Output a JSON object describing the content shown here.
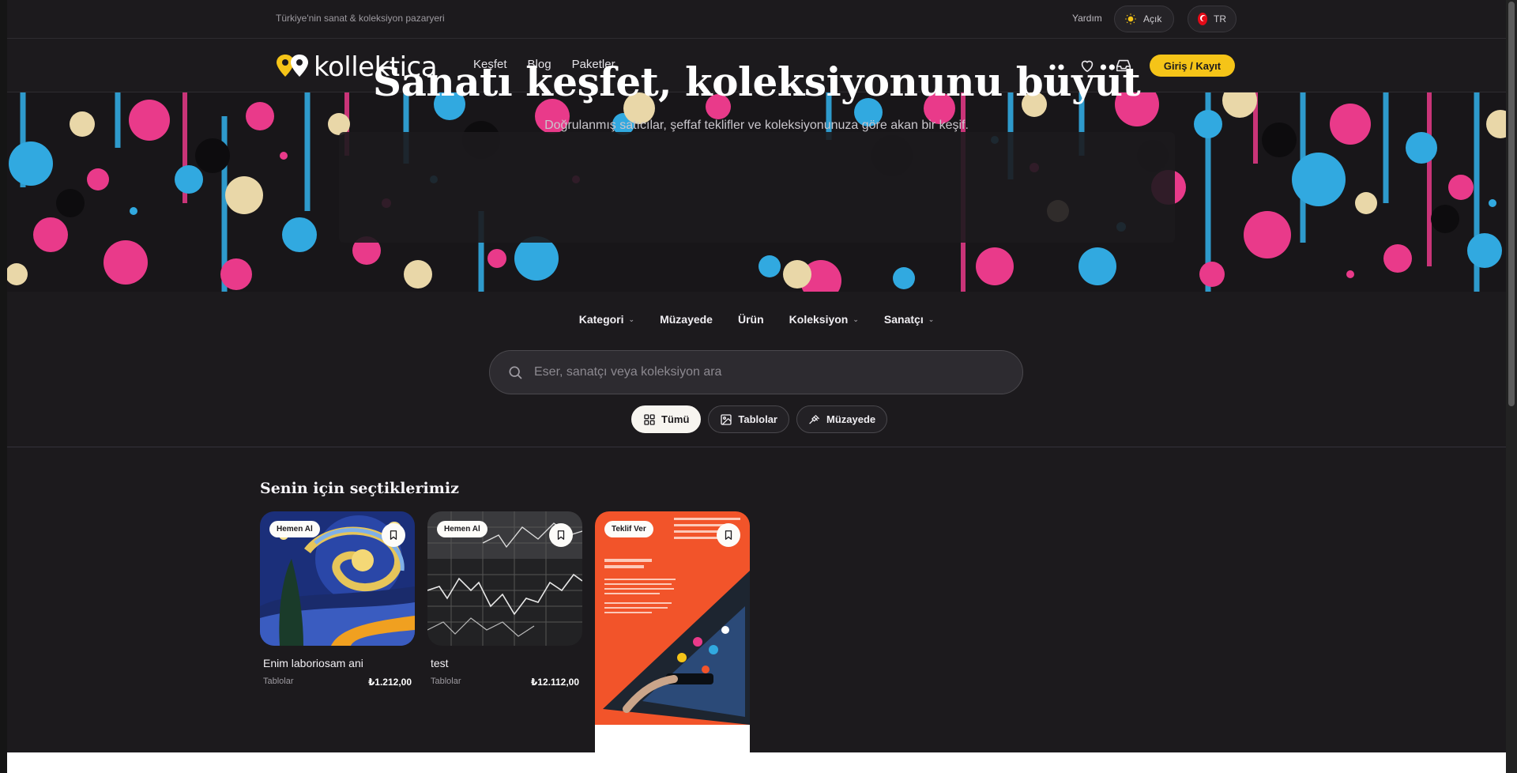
{
  "topbar": {
    "tagline": "Türkiye'nin sanat & koleksiyon pazaryeri",
    "help": "Yardım",
    "theme_label": "Açık",
    "lang_label": "TR"
  },
  "nav": {
    "logo_text": "kollektica",
    "links": [
      "Keşfet",
      "Blog",
      "Paketler"
    ],
    "login_label": "Giriş / Kayıt"
  },
  "hero": {
    "title": "Sanatı keşfet, koleksiyonunu büyüt",
    "subtitle": "Doğrulanmış satıcılar, şeffaf teklifler ve koleksiyonunuza göre akan bir keşif."
  },
  "filters": {
    "tabs": [
      "Kategori",
      "Müzayede",
      "Ürün",
      "Koleksiyon",
      "Sanatçı"
    ],
    "search_placeholder": "Eser, sanatçı veya koleksiyon ara",
    "chips": [
      "Tümü",
      "Tablolar",
      "Müzayede"
    ]
  },
  "picks": {
    "title": "Senin için seçtiklerimiz",
    "cards": [
      {
        "badge": "Hemen Al",
        "title": "Enim laboriosam ani",
        "category": "Tablolar",
        "price": "₺1.212,00"
      },
      {
        "badge": "Hemen Al",
        "title": "test",
        "category": "Tablolar",
        "price": "₺12.112,00"
      },
      {
        "badge": "Teklif Ver"
      }
    ]
  },
  "colors": {
    "background": "#1c1a1d",
    "accent": "#f5c418",
    "splash_pink": "#e93a8a",
    "splash_blue": "#31a9e0",
    "splash_cream": "#e9d7a8"
  },
  "icons": [
    "sun-icon",
    "turkish-flag-icon",
    "heart-icon",
    "inbox-icon",
    "search-icon",
    "grid-icon",
    "image-icon",
    "gavel-icon",
    "bookmark-icon"
  ]
}
